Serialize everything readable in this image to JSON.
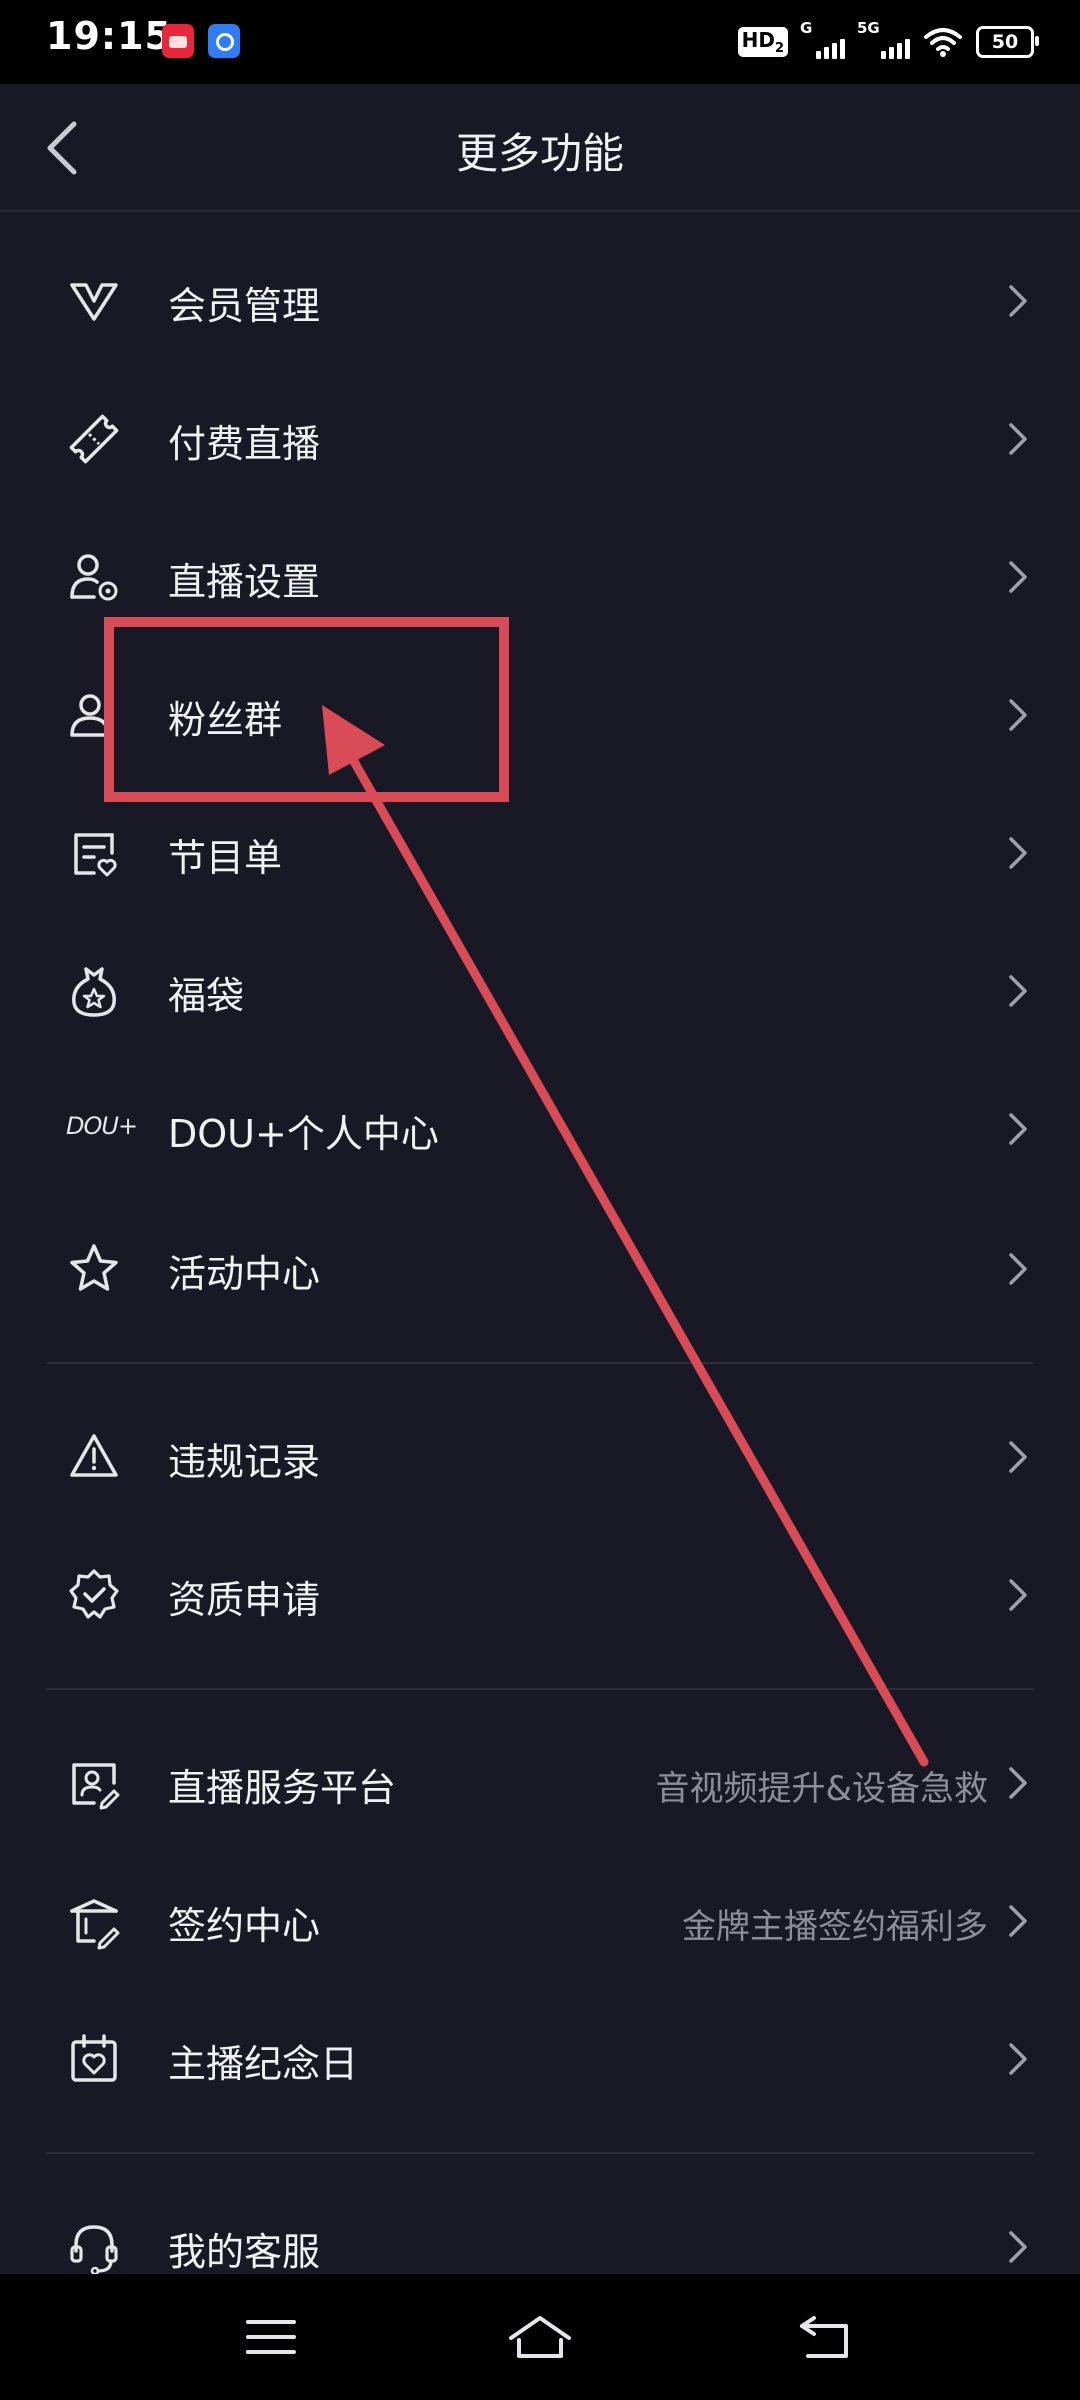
{
  "status_bar": {
    "time": "19:15",
    "network_hd": "HD",
    "network_hd_sub": "2",
    "signal1_label": "G",
    "signal2_label": "5G",
    "battery": "50"
  },
  "header": {
    "title": "更多功能",
    "back_icon": "chevron-left-icon"
  },
  "menu": [
    {
      "label": "会员管理",
      "icon": "vip-diamond-icon"
    },
    {
      "label": "付费直播",
      "icon": "ticket-icon"
    },
    {
      "label": "直播设置",
      "icon": "user-settings-icon"
    },
    {
      "label": "粉丝群",
      "icon": "fans-group-icon"
    },
    {
      "label": "节目单",
      "icon": "program-list-icon"
    },
    {
      "label": "福袋",
      "icon": "lucky-bag-icon"
    },
    {
      "label": "DOU+个人中心",
      "icon": "dou-plus-icon",
      "icon_text": "DOU+"
    },
    {
      "label": "活动中心",
      "icon": "star-icon"
    },
    {
      "label": "违规记录",
      "icon": "warning-icon"
    },
    {
      "label": "资质申请",
      "icon": "verified-badge-icon"
    },
    {
      "label": "直播服务平台",
      "sub": "音视频提升&设备急救",
      "icon": "service-platform-icon"
    },
    {
      "label": "签约中心",
      "sub": "金牌主播签约福利多",
      "icon": "contract-icon"
    },
    {
      "label": "主播纪念日",
      "icon": "calendar-heart-icon"
    },
    {
      "label": "我的客服",
      "icon": "headset-icon"
    }
  ],
  "annotation": {
    "color": "#d94b57",
    "highlight_target": "粉丝群"
  },
  "nav_bar": {
    "buttons": [
      "menu-icon",
      "home-icon",
      "back-icon"
    ]
  },
  "colors": {
    "background": "#181924",
    "text": "#f1f1f4",
    "subtext": "#8c8e98",
    "divider": "#2c2e3a"
  }
}
